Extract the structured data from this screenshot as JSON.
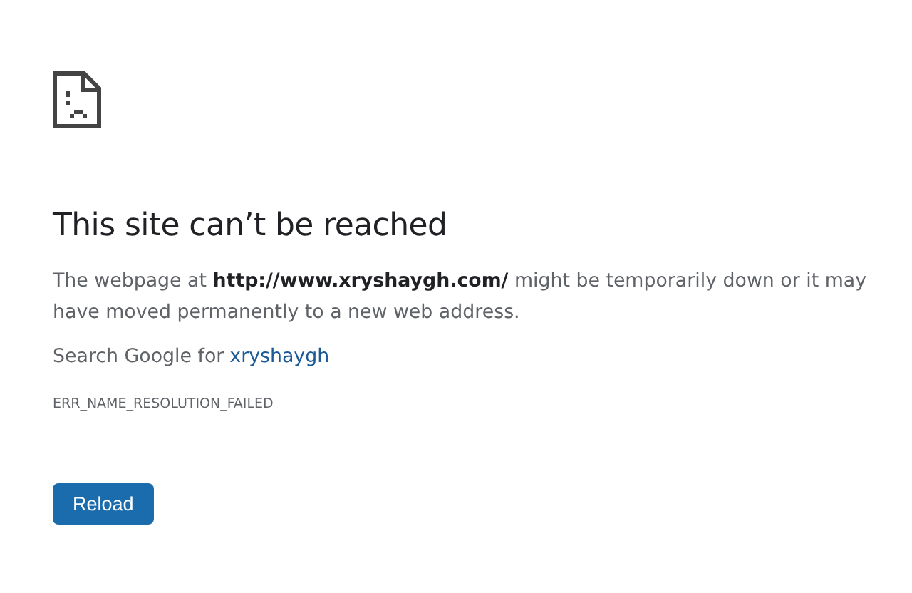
{
  "heading": "This site can’t be reached",
  "message": "The webpage at **http://www.xryshaygh.com/** might be temporarily down or it may have moved permanently to a new web address.",
  "search": {
    "prefix": "Search Google for",
    "link": "xryshaygh"
  },
  "error_code": "ERR_NAME_RESOLUTION_FAILED",
  "buttons": [
    "Reload"
  ]
}
